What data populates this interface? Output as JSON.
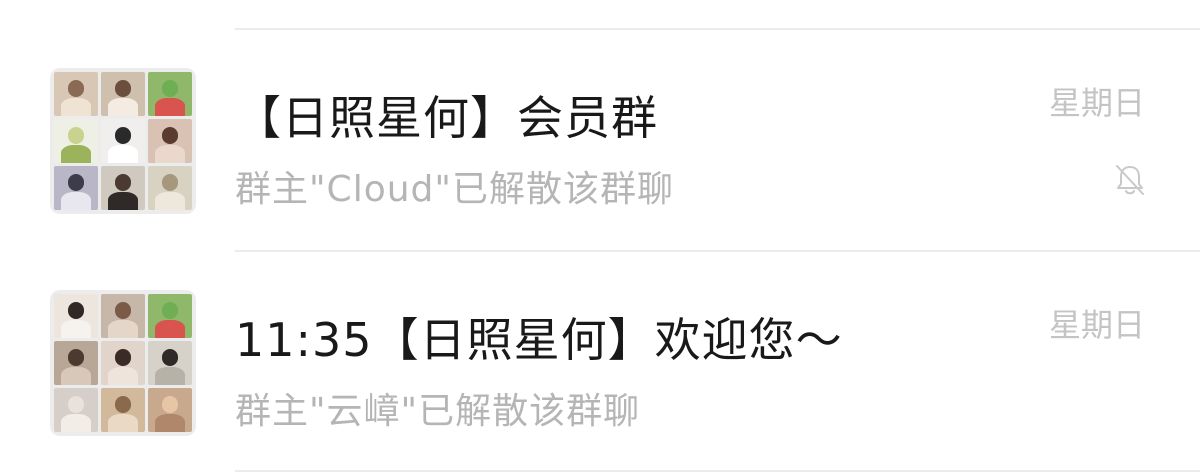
{
  "chats": [
    {
      "title": "【日照星何】会员群",
      "subtitle": "群主\"Cloud\"已解散该群聊",
      "time": "星期日",
      "muted": true,
      "avatar_tiles": [
        {
          "bg": "#d8c7b5",
          "head": "#8a6a55",
          "body": "#efe3d3"
        },
        {
          "bg": "#cfc0ad",
          "head": "#6b4e3c",
          "body": "#f4ece2"
        },
        {
          "bg": "#8fb86a",
          "head": "#6fae52",
          "body": "#d9534f"
        },
        {
          "bg": "#eef0e6",
          "head": "#c9d28f",
          "body": "#9bb35a"
        },
        {
          "bg": "#f1efed",
          "head": "#2a2a2a",
          "body": "#ffffff"
        },
        {
          "bg": "#d9c2b3",
          "head": "#5a3b2e",
          "body": "#ead8cd"
        },
        {
          "bg": "#b9b6c8",
          "head": "#3c3c4a",
          "body": "#e8e6ef"
        },
        {
          "bg": "#cfc9bf",
          "head": "#4a3a31",
          "body": "#2f2a27"
        },
        {
          "bg": "#d8d2c2",
          "head": "#a6987d",
          "body": "#eee8dc"
        }
      ]
    },
    {
      "title": "11:35【日照星何】欢迎您～",
      "subtitle": "群主\"云嶂\"已解散该群聊",
      "time": "星期日",
      "muted": false,
      "avatar_tiles": [
        {
          "bg": "#ece6df",
          "head": "#2f2925",
          "body": "#f6f2ee"
        },
        {
          "bg": "#c7b7a8",
          "head": "#7b5b48",
          "body": "#e4d6c9"
        },
        {
          "bg": "#8fb86a",
          "head": "#6fae52",
          "body": "#d9534f"
        },
        {
          "bg": "#b8a796",
          "head": "#4b3a30",
          "body": "#d8c8ba"
        },
        {
          "bg": "#e0d4cb",
          "head": "#3a2b26",
          "body": "#efe4dc"
        },
        {
          "bg": "#d7d2c9",
          "head": "#2e2a28",
          "body": "#b7b2a8"
        },
        {
          "bg": "#d6cfc9",
          "head": "#e9e2da",
          "body": "#f2ede7"
        },
        {
          "bg": "#d2b99c",
          "head": "#8a6a4c",
          "body": "#e9d9c5"
        },
        {
          "bg": "#c8a98d",
          "head": "#e7c6a6",
          "body": "#b0876a"
        }
      ]
    }
  ]
}
